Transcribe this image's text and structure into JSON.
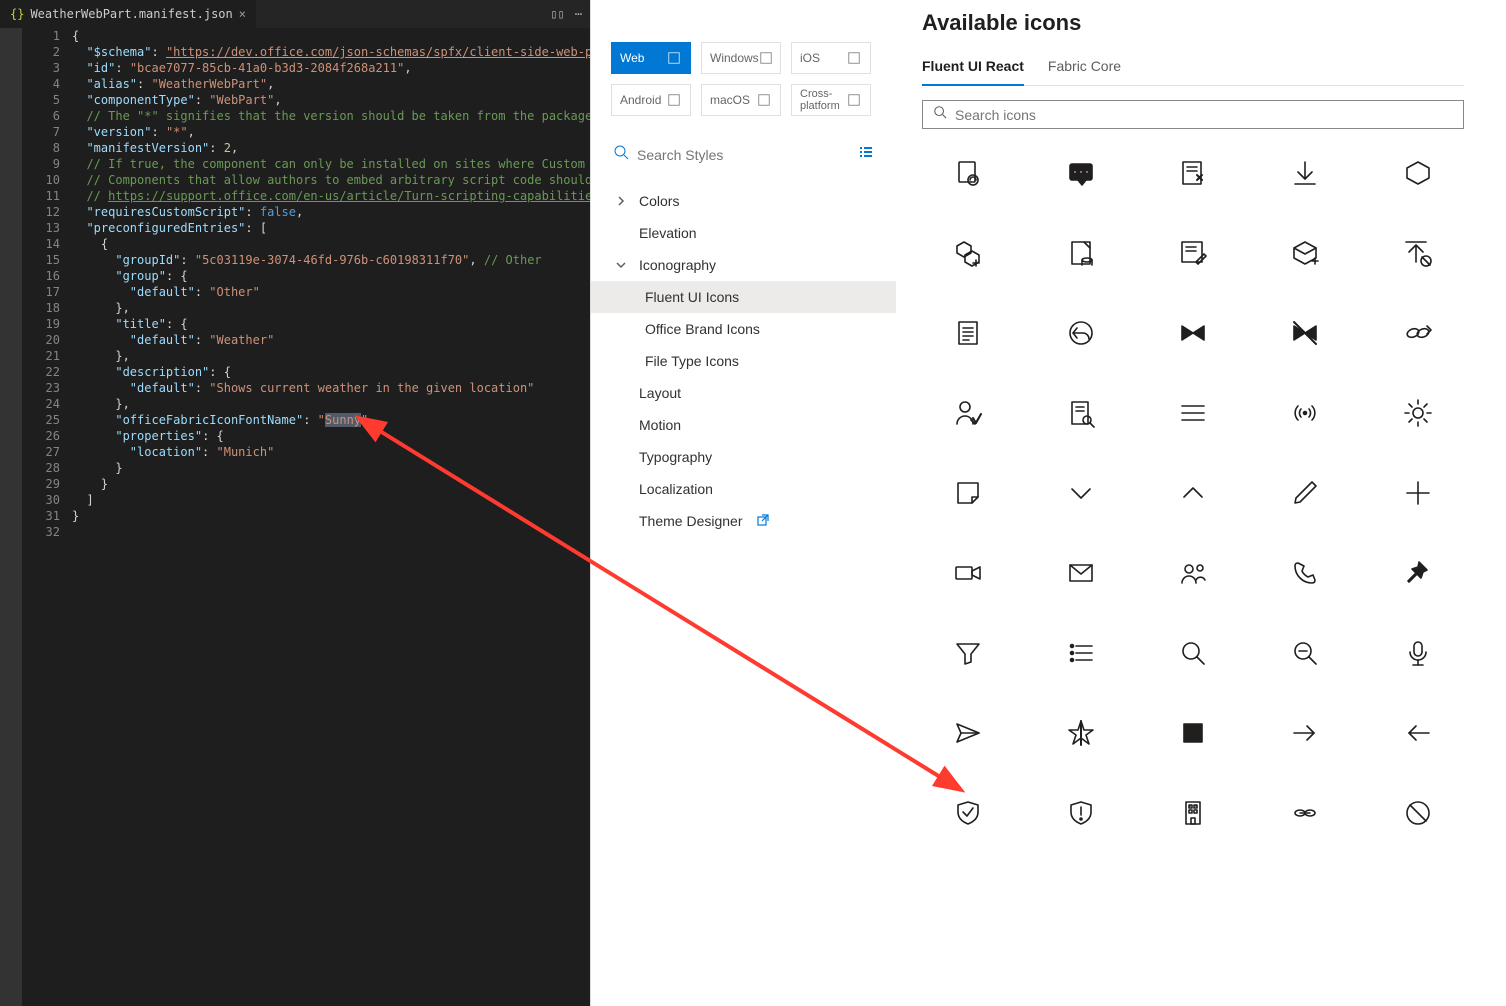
{
  "editor": {
    "tab_filename": "WeatherWebPart.manifest.json",
    "line_count": 32,
    "code_lines": [
      [
        {
          "t": "punc",
          "v": "{"
        }
      ],
      [
        {
          "t": "punc",
          "v": "  "
        },
        {
          "t": "key",
          "v": "\"$schema\""
        },
        {
          "t": "punc",
          "v": ": "
        },
        {
          "t": "link",
          "v": "\"https://dev.office.com/json-schemas/spfx/client-side-web-part-mani"
        }
      ],
      [
        {
          "t": "punc",
          "v": "  "
        },
        {
          "t": "key",
          "v": "\"id\""
        },
        {
          "t": "punc",
          "v": ": "
        },
        {
          "t": "str",
          "v": "\"bcae7077-85cb-41a0-b3d3-2084f268a211\""
        },
        {
          "t": "punc",
          "v": ","
        }
      ],
      [
        {
          "t": "punc",
          "v": "  "
        },
        {
          "t": "key",
          "v": "\"alias\""
        },
        {
          "t": "punc",
          "v": ": "
        },
        {
          "t": "str",
          "v": "\"WeatherWebPart\""
        },
        {
          "t": "punc",
          "v": ","
        }
      ],
      [
        {
          "t": "punc",
          "v": "  "
        },
        {
          "t": "key",
          "v": "\"componentType\""
        },
        {
          "t": "punc",
          "v": ": "
        },
        {
          "t": "str",
          "v": "\"WebPart\""
        },
        {
          "t": "punc",
          "v": ","
        }
      ],
      [
        {
          "t": "punc",
          "v": "  "
        },
        {
          "t": "cmt",
          "v": "// The \"*\" signifies that the version should be taken from the package.json"
        }
      ],
      [
        {
          "t": "punc",
          "v": "  "
        },
        {
          "t": "key",
          "v": "\"version\""
        },
        {
          "t": "punc",
          "v": ": "
        },
        {
          "t": "str",
          "v": "\"*\""
        },
        {
          "t": "punc",
          "v": ","
        }
      ],
      [
        {
          "t": "punc",
          "v": "  "
        },
        {
          "t": "key",
          "v": "\"manifestVersion\""
        },
        {
          "t": "punc",
          "v": ": "
        },
        {
          "t": "num",
          "v": "2"
        },
        {
          "t": "punc",
          "v": ","
        }
      ],
      [
        {
          "t": "punc",
          "v": "  "
        },
        {
          "t": "cmt",
          "v": "// If true, the component can only be installed on sites where Custom Script i"
        }
      ],
      [
        {
          "t": "punc",
          "v": "  "
        },
        {
          "t": "cmt",
          "v": "// Components that allow authors to embed arbitrary script code should set thi"
        }
      ],
      [
        {
          "t": "punc",
          "v": "  "
        },
        {
          "t": "cmt",
          "v": "// "
        },
        {
          "t": "cmt",
          "v": "https://support.office.com/en-us/article/Turn-scripting-capabilities-on-or-",
          "u": true
        }
      ],
      [
        {
          "t": "punc",
          "v": "  "
        },
        {
          "t": "key",
          "v": "\"requiresCustomScript\""
        },
        {
          "t": "punc",
          "v": ": "
        },
        {
          "t": "kwd",
          "v": "false"
        },
        {
          "t": "punc",
          "v": ","
        }
      ],
      [
        {
          "t": "punc",
          "v": "  "
        },
        {
          "t": "key",
          "v": "\"preconfiguredEntries\""
        },
        {
          "t": "punc",
          "v": ": ["
        }
      ],
      [
        {
          "t": "punc",
          "v": "    {"
        }
      ],
      [
        {
          "t": "punc",
          "v": "      "
        },
        {
          "t": "key",
          "v": "\"groupId\""
        },
        {
          "t": "punc",
          "v": ": "
        },
        {
          "t": "str",
          "v": "\"5c03119e-3074-46fd-976b-c60198311f70\""
        },
        {
          "t": "punc",
          "v": ", "
        },
        {
          "t": "cmt",
          "v": "// Other"
        }
      ],
      [
        {
          "t": "punc",
          "v": "      "
        },
        {
          "t": "key",
          "v": "\"group\""
        },
        {
          "t": "punc",
          "v": ": {"
        }
      ],
      [
        {
          "t": "punc",
          "v": "        "
        },
        {
          "t": "key",
          "v": "\"default\""
        },
        {
          "t": "punc",
          "v": ": "
        },
        {
          "t": "str",
          "v": "\"Other\""
        }
      ],
      [
        {
          "t": "punc",
          "v": "      },"
        }
      ],
      [
        {
          "t": "punc",
          "v": "      "
        },
        {
          "t": "key",
          "v": "\"title\""
        },
        {
          "t": "punc",
          "v": ": {"
        }
      ],
      [
        {
          "t": "punc",
          "v": "        "
        },
        {
          "t": "key",
          "v": "\"default\""
        },
        {
          "t": "punc",
          "v": ": "
        },
        {
          "t": "str",
          "v": "\"Weather\""
        }
      ],
      [
        {
          "t": "punc",
          "v": "      },"
        }
      ],
      [
        {
          "t": "punc",
          "v": "      "
        },
        {
          "t": "key",
          "v": "\"description\""
        },
        {
          "t": "punc",
          "v": ": {"
        }
      ],
      [
        {
          "t": "punc",
          "v": "        "
        },
        {
          "t": "key",
          "v": "\"default\""
        },
        {
          "t": "punc",
          "v": ": "
        },
        {
          "t": "str",
          "v": "\"Shows current weather in the given location\""
        }
      ],
      [
        {
          "t": "punc",
          "v": "      },"
        }
      ],
      [
        {
          "t": "punc",
          "v": "      "
        },
        {
          "t": "key",
          "v": "\"officeFabricIconFontName\""
        },
        {
          "t": "punc",
          "v": ": "
        },
        {
          "t": "str",
          "v": "\""
        },
        {
          "t": "str",
          "v": "Sunny",
          "hl": true
        },
        {
          "t": "str",
          "v": "\""
        },
        {
          "t": "punc",
          "v": ","
        }
      ],
      [
        {
          "t": "punc",
          "v": "      "
        },
        {
          "t": "key",
          "v": "\"properties\""
        },
        {
          "t": "punc",
          "v": ": {"
        }
      ],
      [
        {
          "t": "punc",
          "v": "        "
        },
        {
          "t": "key",
          "v": "\"location\""
        },
        {
          "t": "punc",
          "v": ": "
        },
        {
          "t": "str",
          "v": "\"Munich\""
        }
      ],
      [
        {
          "t": "punc",
          "v": "      }"
        }
      ],
      [
        {
          "t": "punc",
          "v": "    }"
        }
      ],
      [
        {
          "t": "punc",
          "v": "  ]"
        }
      ],
      [
        {
          "t": "punc",
          "v": "}"
        }
      ],
      [
        {
          "t": "punc",
          "v": ""
        }
      ]
    ]
  },
  "middle": {
    "platforms": [
      {
        "label": "Web",
        "active": true
      },
      {
        "label": "Windows",
        "active": false
      },
      {
        "label": "iOS",
        "active": false
      },
      {
        "label": "Android",
        "active": false
      },
      {
        "label": "macOS",
        "active": false
      },
      {
        "label": "Cross-\nplatform",
        "active": false,
        "cross": true
      }
    ],
    "search_placeholder": "Search Styles",
    "nav": [
      {
        "label": "Colors",
        "chev": "right",
        "sub": false
      },
      {
        "label": "Elevation",
        "chev": "",
        "sub": false
      },
      {
        "label": "Iconography",
        "chev": "down",
        "sub": false
      },
      {
        "label": "Fluent UI Icons",
        "sub": true,
        "selected": true
      },
      {
        "label": "Office Brand Icons",
        "sub": true
      },
      {
        "label": "File Type Icons",
        "sub": true
      },
      {
        "label": "Layout",
        "sub": false
      },
      {
        "label": "Motion",
        "sub": false
      },
      {
        "label": "Typography",
        "sub": false
      },
      {
        "label": "Localization",
        "sub": false
      },
      {
        "label": "Theme Designer",
        "sub": false,
        "external": true
      }
    ]
  },
  "right": {
    "title": "Available icons",
    "tabs": [
      {
        "label": "Fluent UI React",
        "active": true
      },
      {
        "label": "Fabric Core",
        "active": false
      }
    ],
    "search_placeholder": "Search icons",
    "icons": [
      "page-link",
      "activity-feed",
      "action-center",
      "download",
      "hexagon",
      "build-queue-new",
      "page-data",
      "compose-form",
      "package-add",
      "upload-blocked",
      "text-document",
      "reply-alt",
      "bow-tie",
      "bow-tie-disabled",
      "double-chevron-link",
      "account-activity",
      "page-search",
      "global-nav",
      "streaming",
      "brightness",
      "sticky-note",
      "chevron-down-med",
      "chevron-up-med",
      "edit",
      "add",
      "video",
      "mail",
      "people",
      "phone",
      "pinned-fill",
      "filter",
      "list",
      "search",
      "zoom-out",
      "microphone",
      "send",
      "favorite-star",
      "stop-solid",
      "forward",
      "back",
      "shield-check",
      "shield-alert",
      "office",
      "link",
      "blocked"
    ]
  }
}
